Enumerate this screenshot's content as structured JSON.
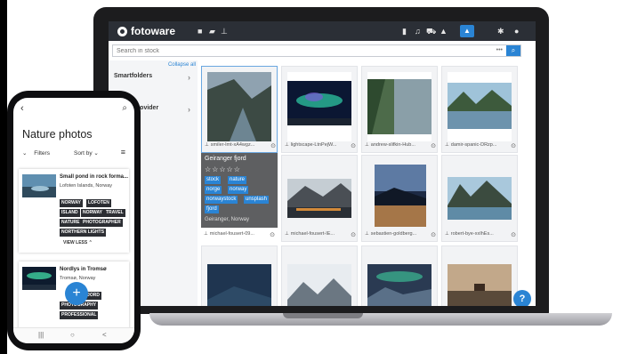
{
  "app": {
    "logo_text": "fotoware",
    "colors": {
      "accent": "#2a84d4",
      "header": "#2b2f36",
      "tag_dark": "#2c2e33"
    }
  },
  "header": {
    "left_icons": [
      "folder-icon",
      "briefcase-icon",
      "pin-icon"
    ],
    "right_icons": [
      "book-icon",
      "bell-icon",
      "cart-icon",
      "graduation-cap-icon",
      "user-icon",
      "gear-icon",
      "avatar-icon"
    ]
  },
  "search": {
    "placeholder": "Search in stock",
    "options_label": "•••"
  },
  "sidebar": {
    "collapse_all": "Collapse all",
    "items": [
      {
        "label": "Smartfolders"
      },
      {
        "label": "Photo Provider"
      }
    ]
  },
  "grid": {
    "tiles": [
      {
        "caption": "smiler-lmt-xA4wgz...",
        "selected": true,
        "icon": "check-icon"
      },
      {
        "caption": "lightscape-LtnPejW...",
        "icon": "check-icon"
      },
      {
        "caption": "andrew-slifkin-Hub...",
        "icon": "check-icon"
      },
      {
        "caption": "damir-spanic-DRzp...",
        "icon": "check-icon"
      },
      {
        "caption": "michael-fousert-09...",
        "icon": "check-icon"
      },
      {
        "caption": "michael-fousert-IE...",
        "icon": "check-icon"
      },
      {
        "caption": "sebastien-goldberg...",
        "icon": "check-icon"
      },
      {
        "caption": "robert-bye-xxIhEs...",
        "icon": "check-icon"
      }
    ],
    "info_panel": {
      "title": "Geiranger fjord",
      "stars": "☆☆☆☆☆",
      "tags": [
        "stock",
        "nature",
        "norge",
        "norway",
        "norwaystock",
        "unsplash",
        "fjord"
      ],
      "footer": "Geiranger, Norway"
    },
    "help_label": "?"
  },
  "phone": {
    "title": "Nature photos",
    "filters_label": "Filters",
    "sort_label": "Sort by",
    "cards": [
      {
        "name": "Small pond in rock forma...",
        "location": "Lofoten Islands, Norway",
        "tags": [
          "NORWAY",
          "LOFOTEN",
          "ISLAND",
          "NORWAY",
          "TRAVEL",
          "NATURE",
          "PHOTOGRAPHER",
          "NORTHERN LIGHTS"
        ],
        "view_less": "VIEW LESS"
      },
      {
        "name": "Nordlys in Tromsø",
        "location": "Tromsø, Norway",
        "tags": [
          "FJORD",
          "PHOTOGRAPHY",
          "PROFESSIONAL"
        ]
      }
    ],
    "fab_label": "+",
    "nav": [
      "|||",
      "○",
      "<"
    ]
  }
}
